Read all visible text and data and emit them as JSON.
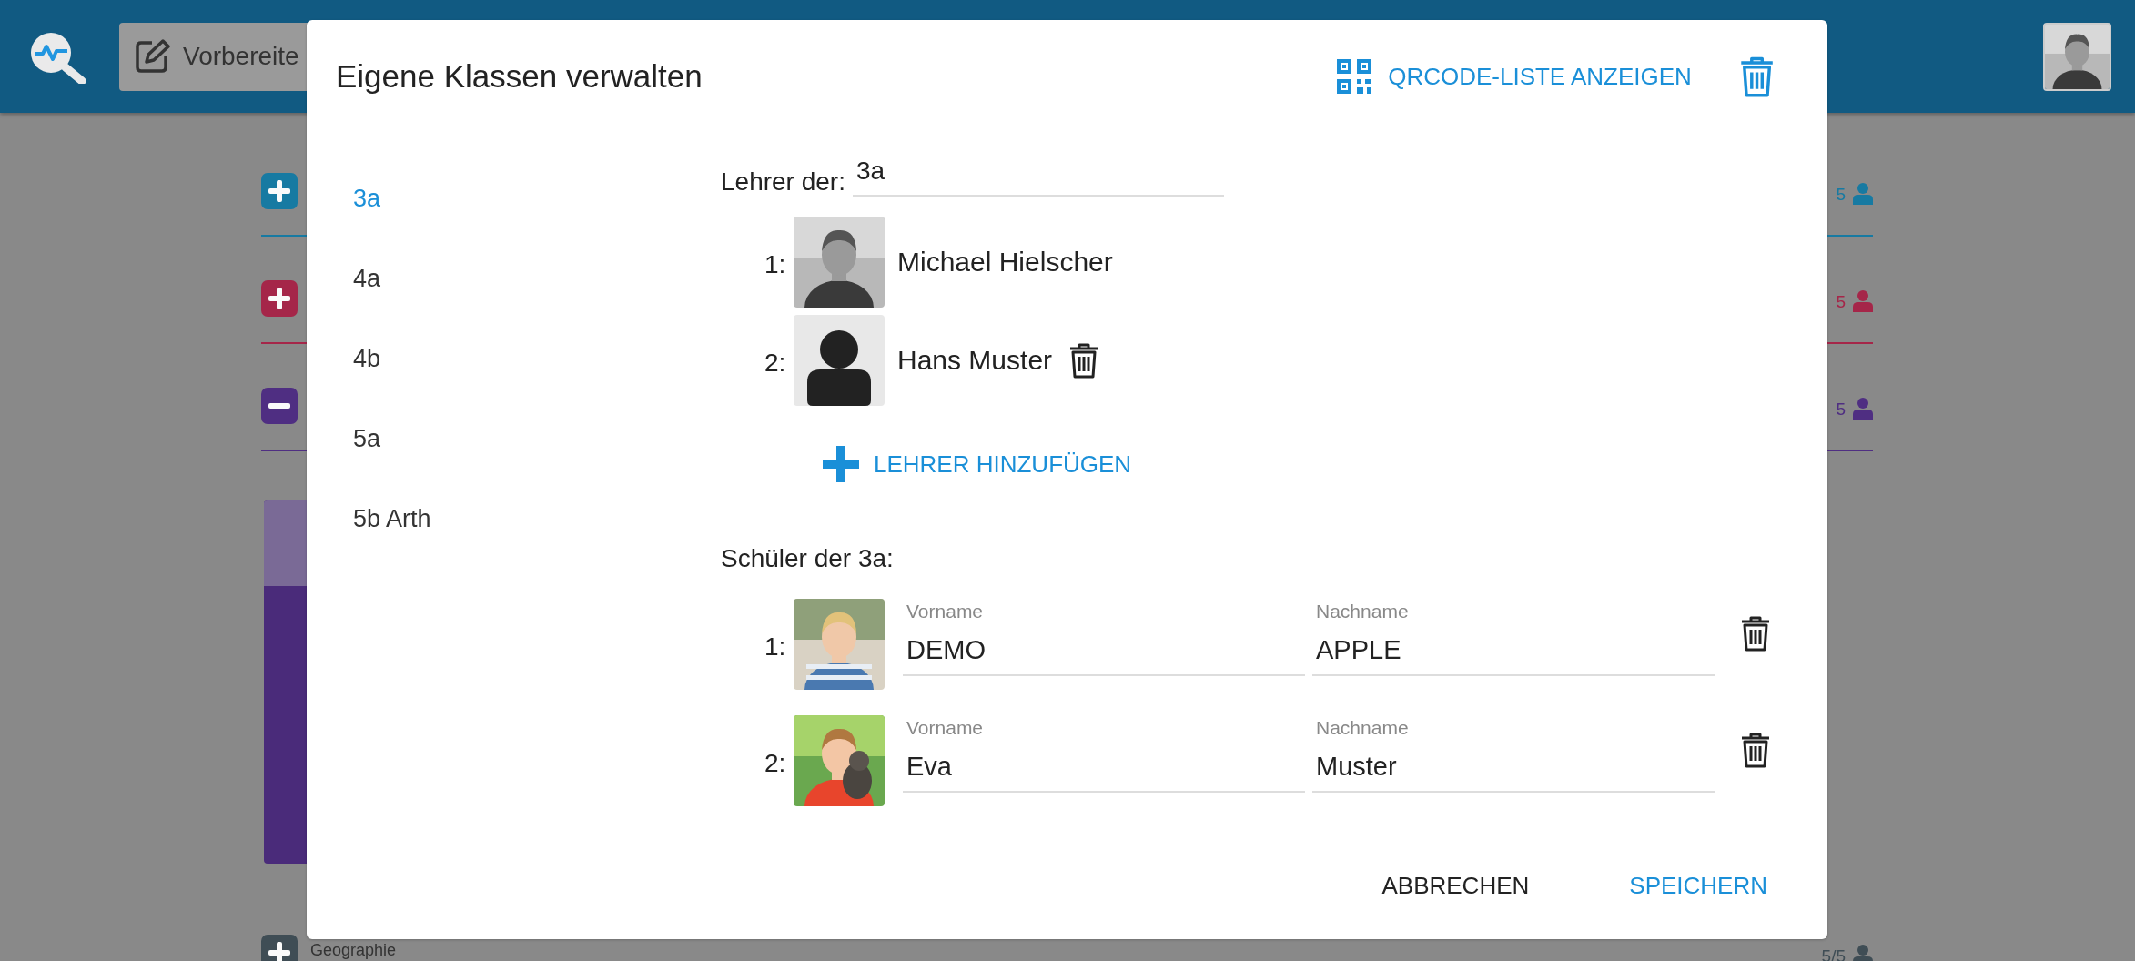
{
  "header": {
    "app_button": "Vorbereite"
  },
  "subjects": [
    {
      "expanded": false,
      "color": "#177aa2",
      "count": "5"
    },
    {
      "expanded": false,
      "color": "#a52649",
      "count": "5"
    },
    {
      "expanded": true,
      "color": "#4f2e82",
      "count": "5"
    },
    {
      "expanded": false,
      "color": "#3f4d55",
      "name": "Geographie",
      "count": "5/5"
    }
  ],
  "dialog": {
    "title": "Eigene Klassen verwalten",
    "qr_button": "QRCODE-LISTE ANZEIGEN",
    "classes": [
      {
        "label": "3a",
        "selected": true
      },
      {
        "label": "4a",
        "selected": false
      },
      {
        "label": "4b",
        "selected": false
      },
      {
        "label": "5a",
        "selected": false
      },
      {
        "label": "5b Arth",
        "selected": false
      }
    ],
    "teachers_label": "Lehrer der:",
    "class_name": "3a",
    "teachers": [
      {
        "number": "1:",
        "name": "Michael Hielscher",
        "kind": "picture",
        "deletable": false
      },
      {
        "number": "2:",
        "name": "Hans Muster",
        "kind": "placeholder",
        "deletable": true
      }
    ],
    "add_teacher": "LEHRER HINZUFÜGEN",
    "students_label": "Schüler der 3a:",
    "students": [
      {
        "number": "1:",
        "first_name_label": "Vorname",
        "first_name": "DEMO",
        "last_name_label": "Nachname",
        "last_name": "APPLE"
      },
      {
        "number": "2:",
        "first_name_label": "Vorname",
        "first_name": "Eva",
        "last_name_label": "Nachname",
        "last_name": "Muster"
      }
    ],
    "buttons": {
      "cancel": "ABBRECHEN",
      "save": "SPEICHERN"
    }
  }
}
